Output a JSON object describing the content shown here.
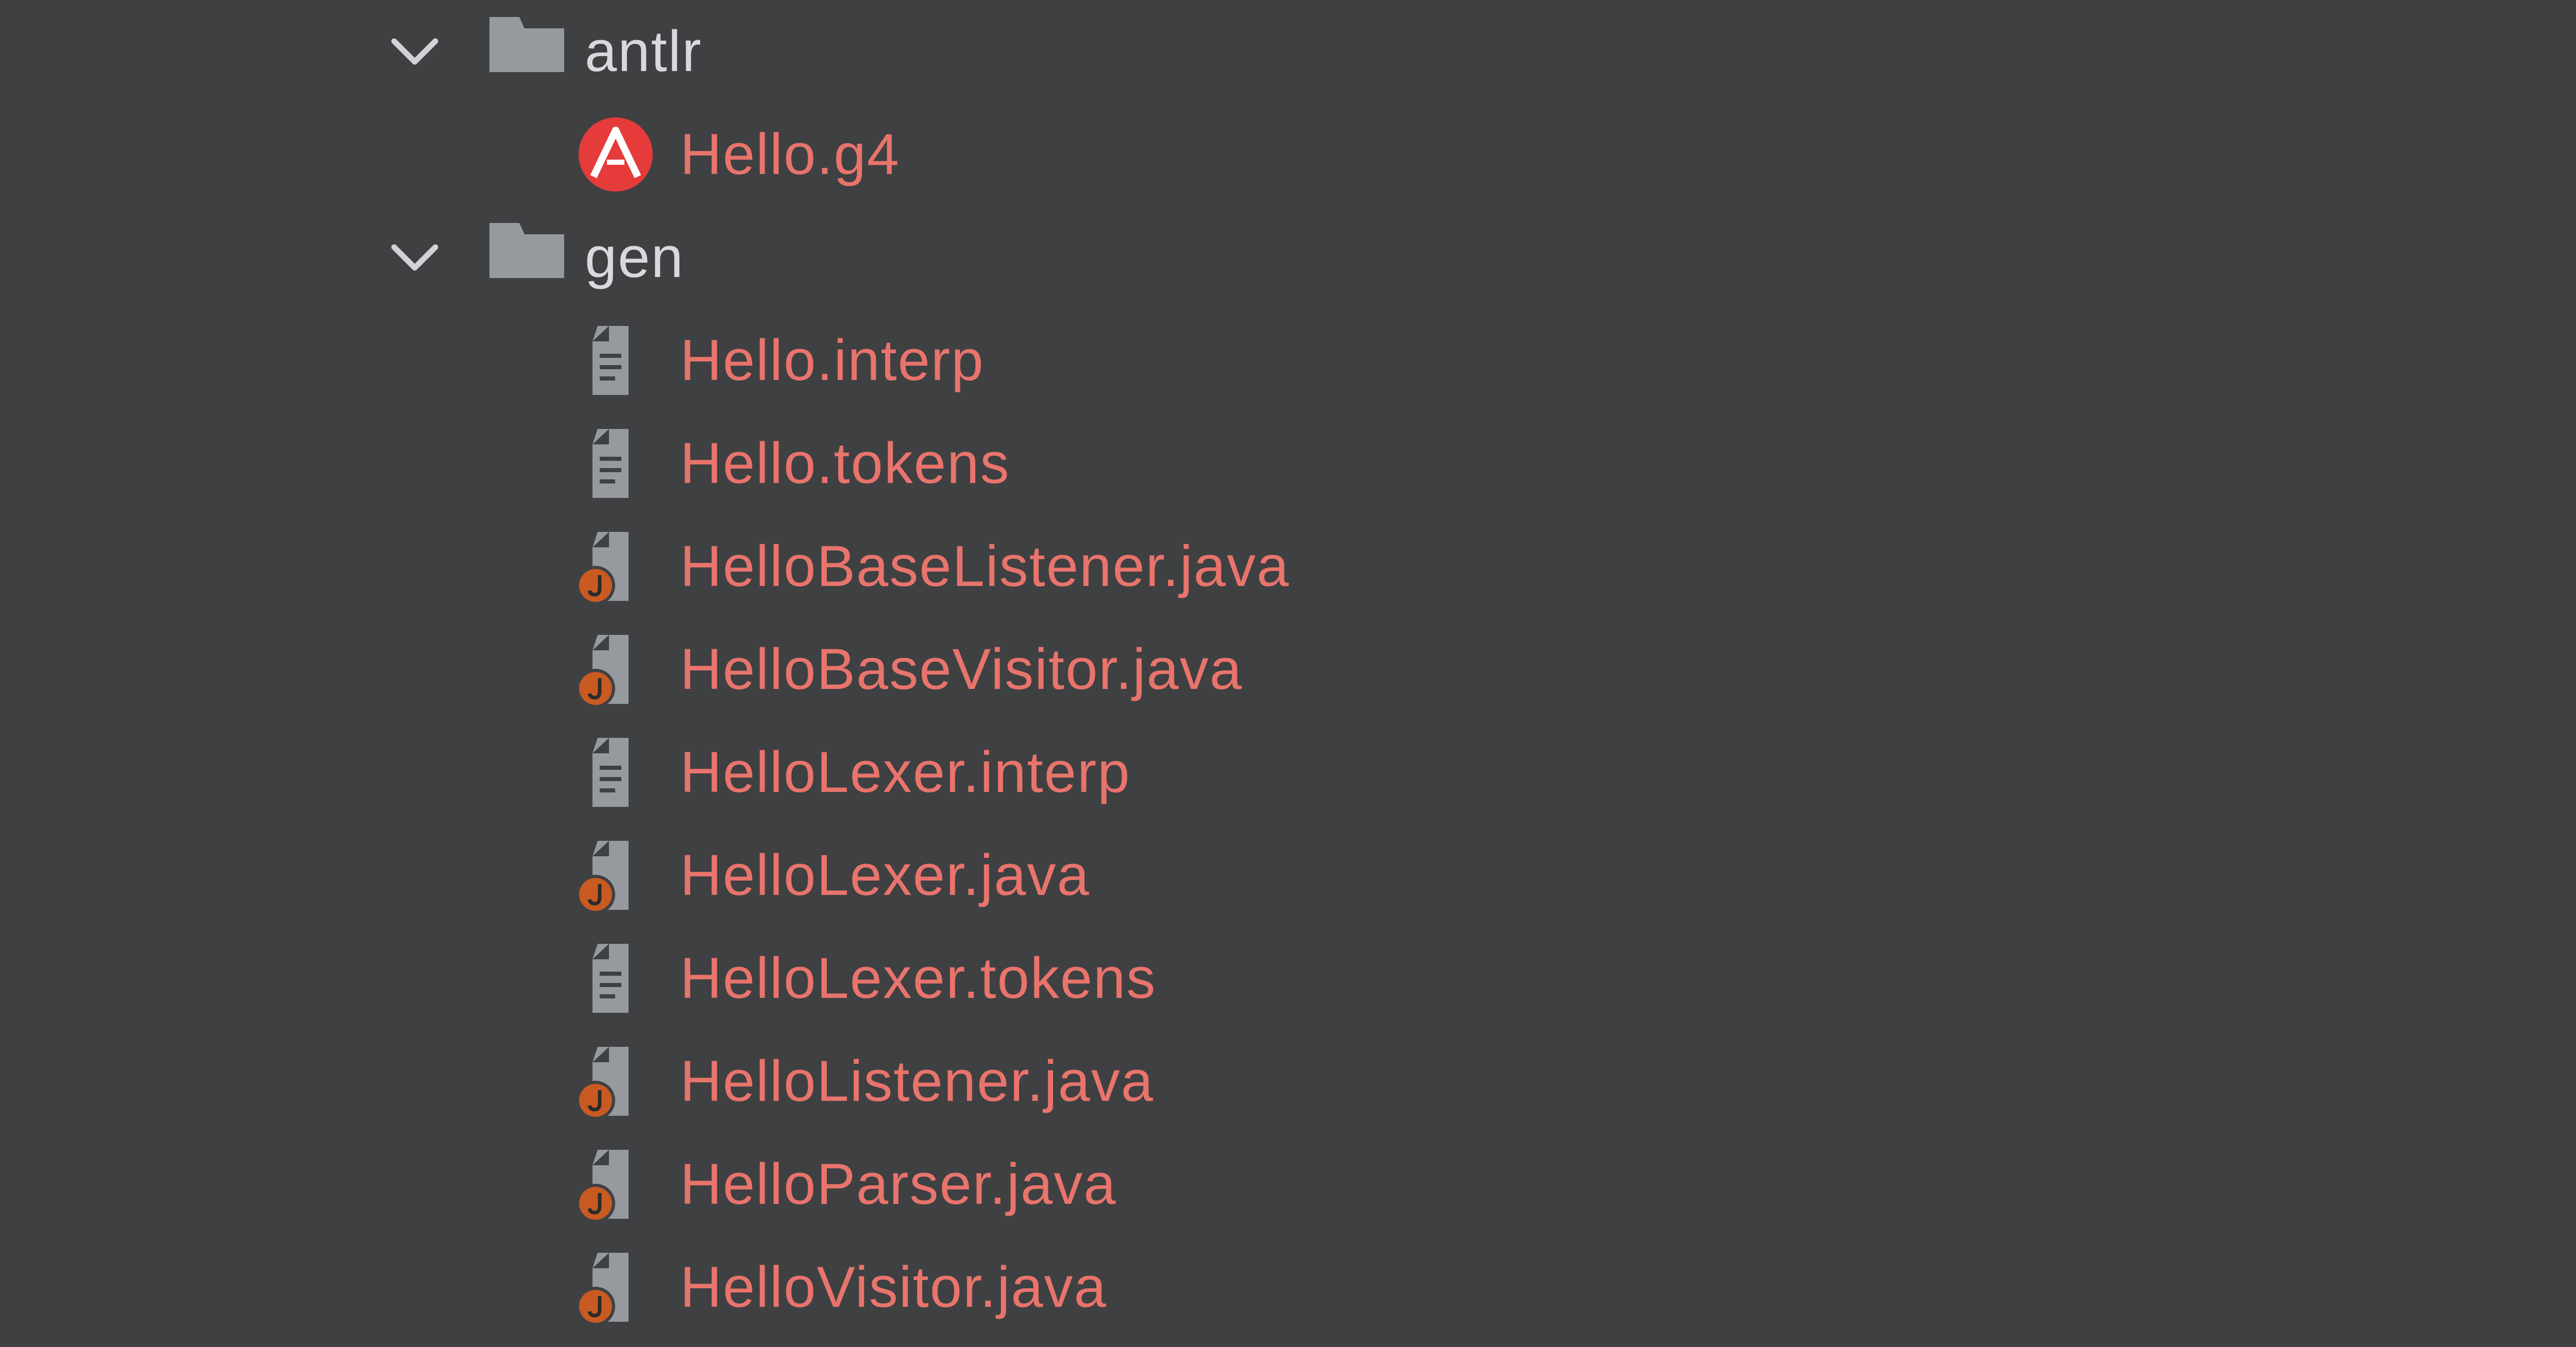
{
  "theme": {
    "background": "#3f4042",
    "folder_text_color": "#d7d9dc",
    "file_text_color": "#e8746c",
    "icon_gray": "#96999e",
    "java_badge": "#c85a22",
    "antlr_red": "#e53b3b"
  },
  "tree": {
    "folders": [
      {
        "name": "antlr",
        "icon": "folder-icon",
        "expand_icon": "chevron-down-icon",
        "children": [
          {
            "name": "Hello.g4",
            "icon": "antlr-icon"
          }
        ]
      },
      {
        "name": "gen",
        "icon": "folder-icon",
        "expand_icon": "chevron-down-icon",
        "children": [
          {
            "name": "Hello.interp",
            "icon": "text-file-icon"
          },
          {
            "name": "Hello.tokens",
            "icon": "text-file-icon"
          },
          {
            "name": "HelloBaseListener.java",
            "icon": "java-file-icon"
          },
          {
            "name": "HelloBaseVisitor.java",
            "icon": "java-file-icon"
          },
          {
            "name": "HelloLexer.interp",
            "icon": "text-file-icon"
          },
          {
            "name": "HelloLexer.java",
            "icon": "java-file-icon"
          },
          {
            "name": "HelloLexer.tokens",
            "icon": "text-file-icon"
          },
          {
            "name": "HelloListener.java",
            "icon": "java-file-icon"
          },
          {
            "name": "HelloParser.java",
            "icon": "java-file-icon"
          },
          {
            "name": "HelloVisitor.java",
            "icon": "java-file-icon"
          }
        ]
      }
    ]
  }
}
